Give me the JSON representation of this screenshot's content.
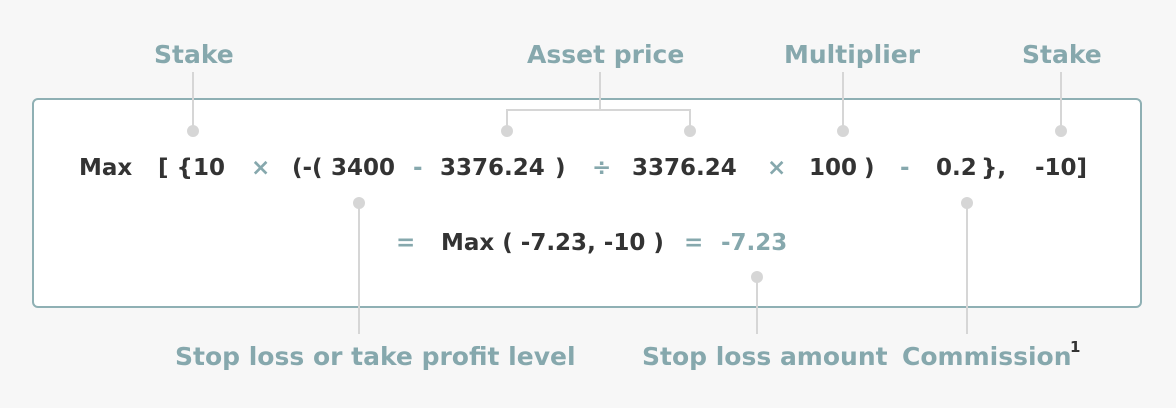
{
  "labels": {
    "stake_left": "Stake",
    "asset_price": "Asset price",
    "multiplier": "Multiplier",
    "stake_right": "Stake",
    "stop_loss_level": "Stop loss or take profit level",
    "stop_loss_amount": "Stop loss amount",
    "commission": "Commission",
    "commission_footnote": "1"
  },
  "formula": {
    "max": "Max",
    "open": "[ {",
    "stake": "10",
    "times1": "×",
    "paren_open": "(-(",
    "level": "3400",
    "minus1": "-",
    "price1": "3376.24",
    "close1": ")",
    "divide": "÷",
    "price2": "3376.24",
    "times2": "×",
    "multiplier": "100",
    "close2": ")",
    "minus2": "-",
    "commission": "0.2",
    "brace_close": "},",
    "neg_stake": "-10]"
  },
  "result": {
    "equals1": "=",
    "max_expr": "Max ( -7.23, -10 )",
    "equals2": "=",
    "value": "-7.23"
  },
  "colors": {
    "accent": "#86a8ad",
    "text": "#333333",
    "connector": "#d6d6d6",
    "border": "#8fb0b4",
    "background": "#f7f7f7"
  }
}
